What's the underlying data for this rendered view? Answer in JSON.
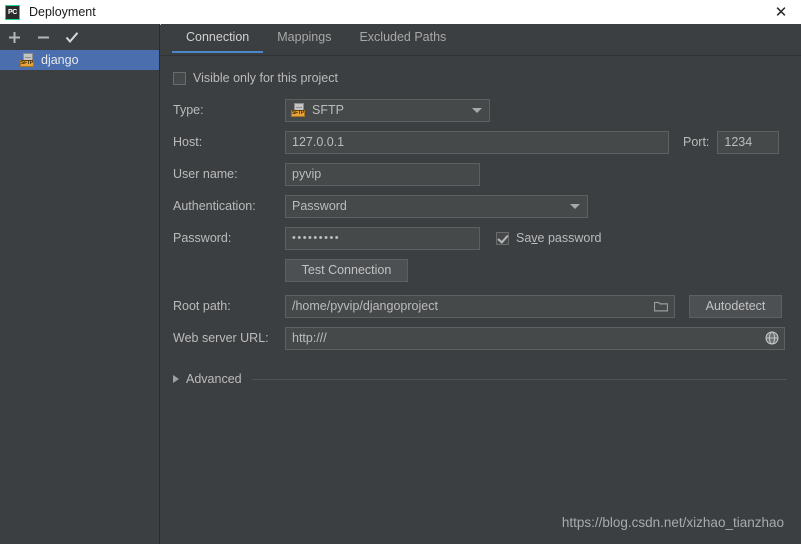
{
  "window": {
    "title": "Deployment",
    "app_icon": "pycharm-pc-icon",
    "close_icon": "close-icon",
    "accent_color": "#4a88c7",
    "selection_color": "#4b6eaf",
    "background_color": "#3c3f41"
  },
  "sidebar": {
    "toolbar": [
      {
        "name": "add-button",
        "icon": "plus-icon",
        "label": "+"
      },
      {
        "name": "remove-button",
        "icon": "minus-icon",
        "label": "−"
      },
      {
        "name": "set-default-button",
        "icon": "check-icon",
        "label": "✓"
      }
    ],
    "items": [
      {
        "label": "django",
        "icon": "sftp-server-icon",
        "icon_tag": "SFTP",
        "selected": true
      }
    ]
  },
  "tabs": [
    {
      "label": "Connection",
      "active": true
    },
    {
      "label": "Mappings",
      "active": false
    },
    {
      "label": "Excluded Paths",
      "active": false
    }
  ],
  "form": {
    "visible_only": {
      "label": "Visible only for this project",
      "checked": false
    },
    "type": {
      "label": "Type:",
      "value": "SFTP",
      "icon": "sftp-server-icon",
      "icon_tag": "SFTP"
    },
    "host": {
      "label": "Host:",
      "value": "127.0.0.1"
    },
    "port": {
      "label": "Port:",
      "value": "1234"
    },
    "user_name": {
      "label": "User name:",
      "value": "pyvip"
    },
    "authentication": {
      "label": "Authentication:",
      "value": "Password"
    },
    "password": {
      "label": "Password:",
      "value": "•••••••••"
    },
    "save_password": {
      "label_before": "Sa",
      "label_mnemonic": "v",
      "label_after": "e password",
      "checked": true
    },
    "test_connection": {
      "label": "Test Connection"
    },
    "root_path": {
      "label": "Root path:",
      "value": "/home/pyvip/djangoproject",
      "browse_icon": "folder-icon"
    },
    "autodetect": {
      "label": "Autodetect"
    },
    "web_server_url": {
      "label": "Web server URL:",
      "value": "http:///",
      "action_icon": "globe-icon"
    },
    "advanced": {
      "label": "Advanced",
      "icon": "chevron-right-icon",
      "expanded": false
    }
  },
  "watermark": {
    "text": "https://blog.csdn.net/xizhao_tianzhao"
  }
}
